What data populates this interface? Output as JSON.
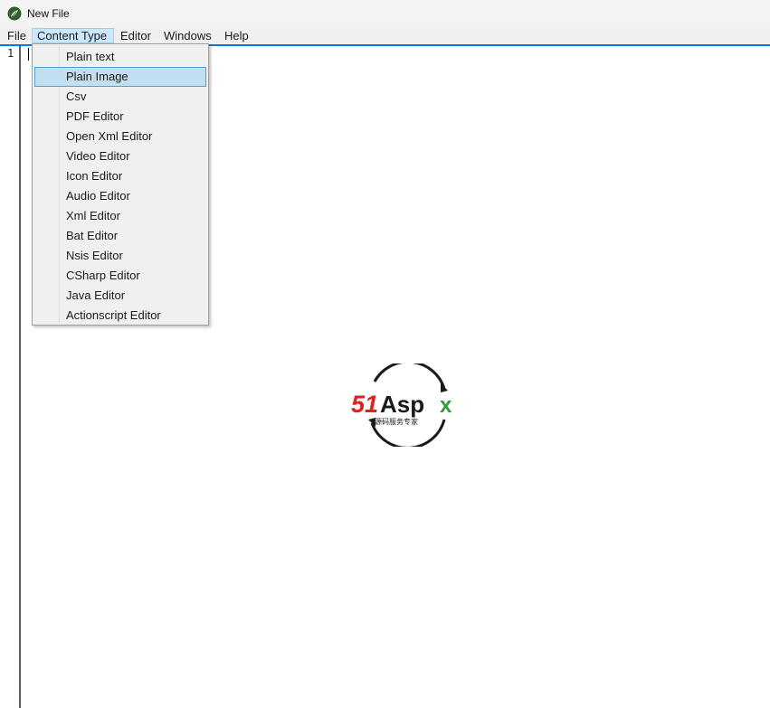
{
  "window": {
    "title": "New File"
  },
  "menubar": {
    "items": [
      {
        "label": "File"
      },
      {
        "label": "Content Type"
      },
      {
        "label": "Editor"
      },
      {
        "label": "Windows"
      },
      {
        "label": "Help"
      }
    ]
  },
  "editor": {
    "line_number": "1"
  },
  "content_type_menu": {
    "items": [
      {
        "label": "Plain text"
      },
      {
        "label": "Plain Image"
      },
      {
        "label": "Csv"
      },
      {
        "label": "PDF Editor"
      },
      {
        "label": "Open Xml Editor"
      },
      {
        "label": "Video Editor"
      },
      {
        "label": "Icon Editor"
      },
      {
        "label": "Audio Editor"
      },
      {
        "label": "Xml Editor"
      },
      {
        "label": "Bat Editor"
      },
      {
        "label": "Nsis Editor"
      },
      {
        "label": "CSharp Editor"
      },
      {
        "label": "Java Editor"
      },
      {
        "label": "Actionscript Editor"
      }
    ],
    "highlighted": "Plain Image"
  },
  "watermark": {
    "brand_red": "51",
    "brand_black": "Asp",
    "brand_green": "x",
    "tagline": "源码服务专家"
  },
  "colors": {
    "accent": "#0078d7",
    "menu_active": "#cce8ff",
    "item_hover": "#c2dff0",
    "logo_red": "#e02020",
    "logo_green": "#2e9e3a"
  }
}
